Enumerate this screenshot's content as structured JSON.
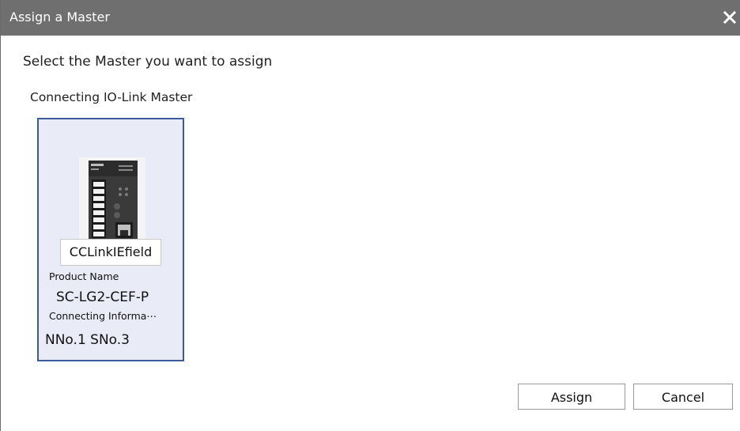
{
  "dialog": {
    "title": "Assign a Master",
    "close_icon": "close-icon",
    "instruction": "Select the Master you want to assign",
    "section_label": "Connecting IO-Link Master"
  },
  "master_card": {
    "image": "io-link-master-device-image",
    "network": "CCLinkIEfield",
    "product_name_label": "Product Name",
    "product_name": "SC-LG2-CEF-P",
    "connecting_info_label": "Connecting Informa⋯",
    "connecting_info": "NNo.1 SNo.3",
    "selected": true
  },
  "buttons": {
    "assign_label": "Assign",
    "cancel_label": "Cancel"
  },
  "colors": {
    "titlebar": "#6f6f6f",
    "card_border": "#3d5a9a",
    "card_background": "#e9ebf7"
  }
}
